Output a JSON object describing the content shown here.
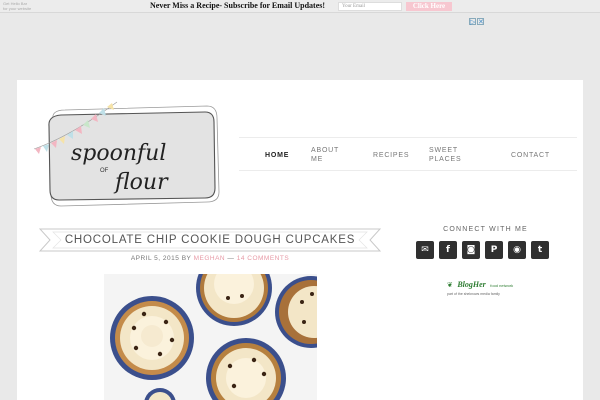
{
  "hellobar": {
    "brand_line1": "Get",
    "brand_line2": "Hello Bar",
    "brand_line3": "for your website",
    "message": "Never Miss a Recipe- Subscribe for Email Updates!",
    "email_placeholder": "Your Email",
    "button_label": "Click Here"
  },
  "logo": {
    "line1": "spoonful",
    "line2": "OF",
    "line3": "flour"
  },
  "nav": {
    "items": [
      {
        "label": "HOME",
        "active": true
      },
      {
        "label": "ABOUT ME"
      },
      {
        "label": "RECIPES"
      },
      {
        "label": "SWEET PLACES"
      },
      {
        "label": "CONTACT"
      }
    ]
  },
  "post": {
    "title": "CHOCOLATE CHIP COOKIE DOUGH CUPCAKES",
    "date": "APRIL 5, 2015",
    "by": "BY",
    "author": "MEGHAN",
    "separator": "—",
    "comments": "14 COMMENTS"
  },
  "sidebar": {
    "connect_title": "CONNECT WITH ME",
    "social": [
      {
        "name": "email-icon",
        "glyph": "✉"
      },
      {
        "name": "facebook-icon",
        "glyph": "f"
      },
      {
        "name": "instagram-icon",
        "glyph": "◙"
      },
      {
        "name": "pinterest-icon",
        "glyph": "P"
      },
      {
        "name": "rss-icon",
        "glyph": "◉"
      },
      {
        "name": "twitter-icon",
        "glyph": "t"
      }
    ],
    "blogher_name": "BlogHer",
    "blogher_sub": "food network",
    "blogher_tagline": "part of the sheknows media family"
  },
  "colors": {
    "accent_pink": "#e79aa6",
    "dark_icon": "#303030",
    "page_bg": "#e9e9e9"
  }
}
